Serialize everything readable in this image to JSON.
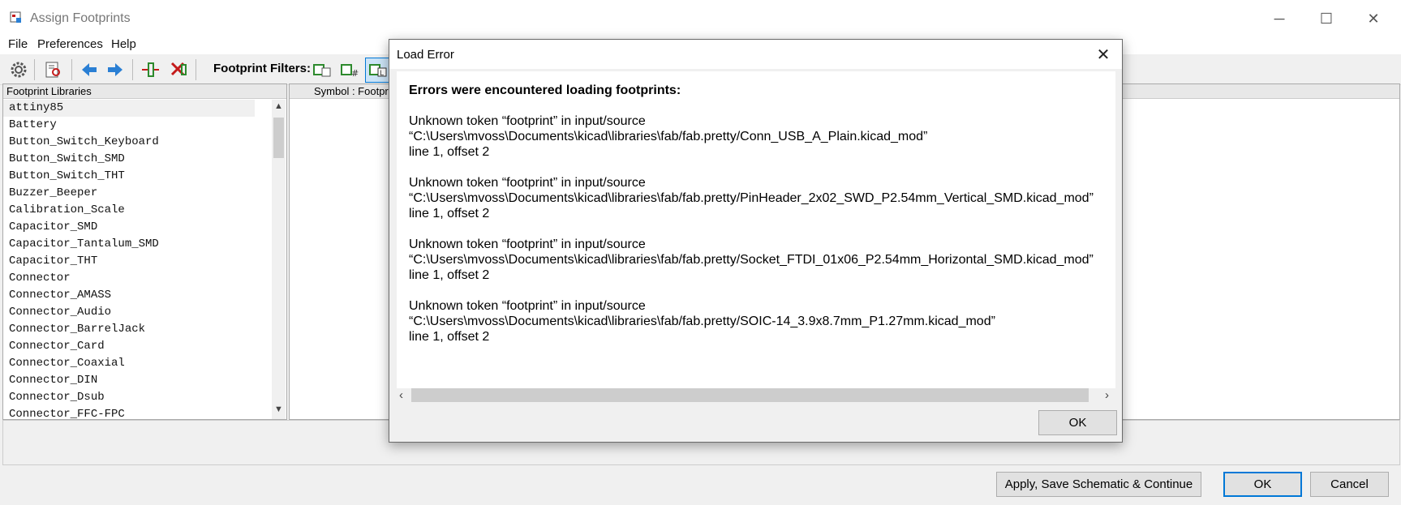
{
  "window": {
    "title": "Assign Footprints",
    "controls": [
      "─",
      "☐",
      "✕"
    ]
  },
  "menu": [
    "File",
    "Preferences",
    "Help"
  ],
  "toolbar": {
    "filters_label": "Footprint Filters:"
  },
  "library_panel": {
    "header": "Footprint Libraries",
    "items": [
      "attiny85",
      "Battery",
      "Button_Switch_Keyboard",
      "Button_Switch_SMD",
      "Button_Switch_THT",
      "Buzzer_Beeper",
      "Calibration_Scale",
      "Capacitor_SMD",
      "Capacitor_Tantalum_SMD",
      "Capacitor_THT",
      "Connector",
      "Connector_AMASS",
      "Connector_Audio",
      "Connector_BarrelJack",
      "Connector_Card",
      "Connector_Coaxial",
      "Connector_DIN",
      "Connector_Dsub",
      "Connector_FFC-FPC"
    ]
  },
  "symbol_panel": {
    "header": "Symbol : Footprint A"
  },
  "bottom_buttons": {
    "apply": "Apply, Save Schematic & Continue",
    "ok": "OK",
    "cancel": "Cancel"
  },
  "dialog": {
    "title": "Load Error",
    "heading": "Errors were encountered loading footprints:",
    "errors": [
      {
        "line1": "Unknown token “footprint” in input/source",
        "line2": "“C:\\Users\\mvoss\\Documents\\kicad\\libraries\\fab/fab.pretty/Conn_USB_A_Plain.kicad_mod”",
        "line3": "line 1, offset 2"
      },
      {
        "line1": "Unknown token “footprint” in input/source",
        "line2": "“C:\\Users\\mvoss\\Documents\\kicad\\libraries\\fab/fab.pretty/PinHeader_2x02_SWD_P2.54mm_Vertical_SMD.kicad_mod”",
        "line3": "line 1, offset 2"
      },
      {
        "line1": "Unknown token “footprint” in input/source",
        "line2": "“C:\\Users\\mvoss\\Documents\\kicad\\libraries\\fab/fab.pretty/Socket_FTDI_01x06_P2.54mm_Horizontal_SMD.kicad_mod”",
        "line3": "line 1, offset 2"
      },
      {
        "line1": "Unknown token “footprint” in input/source",
        "line2": "“C:\\Users\\mvoss\\Documents\\kicad\\libraries\\fab/fab.pretty/SOIC-14_3.9x8.7mm_P1.27mm.kicad_mod”",
        "line3": "line 1, offset 2"
      }
    ],
    "ok_label": "OK"
  },
  "colors": {
    "accent": "#0078d7",
    "arrow_blue": "#2a7fd4",
    "icon_red": "#c41a1a"
  }
}
